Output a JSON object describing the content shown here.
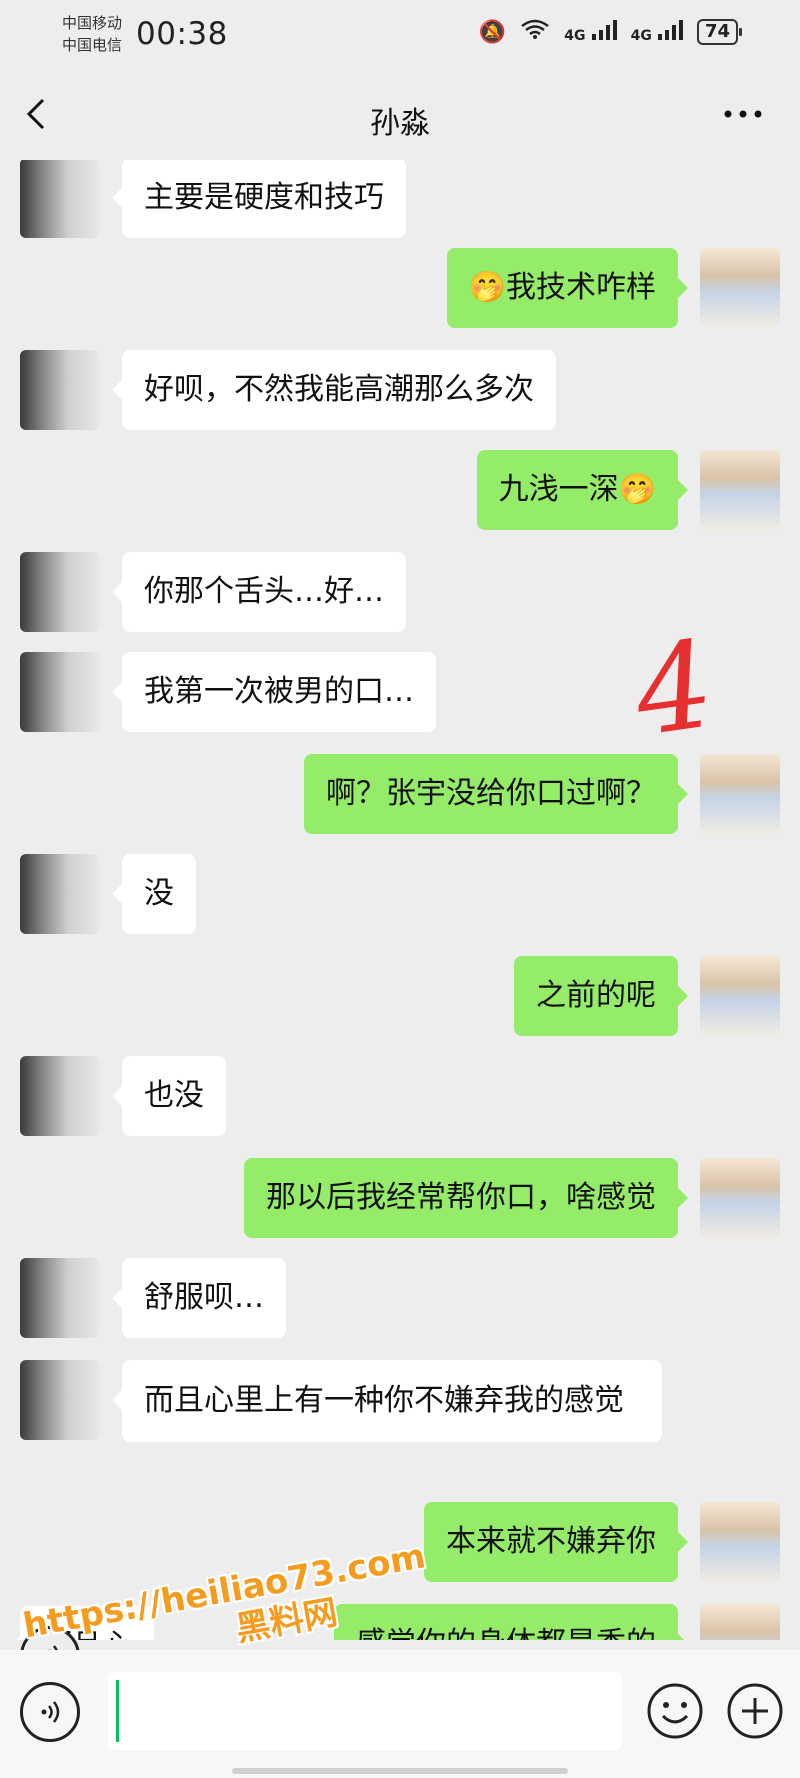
{
  "status_bar": {
    "carrier_1": "中国移动",
    "carrier_2": "中国电信",
    "time": "00:38",
    "signal_1": "4G",
    "signal_2": "4G",
    "battery": "74"
  },
  "header": {
    "title": "孙淼"
  },
  "messages": [
    {
      "side": "in",
      "text": "主要是硬度和技巧"
    },
    {
      "side": "out",
      "text": "我技术咋样",
      "emoji_before": "🤭"
    },
    {
      "side": "in",
      "text": "好呗，不然我能高潮那么多次"
    },
    {
      "side": "out",
      "text": "九浅一深",
      "emoji_after": "🤭"
    },
    {
      "side": "in",
      "text": "你那个舌头…好…"
    },
    {
      "side": "in",
      "text": "我第一次被男的口…"
    },
    {
      "side": "out",
      "text": "啊？张宇没给你口过啊？"
    },
    {
      "side": "in",
      "text": "没"
    },
    {
      "side": "out",
      "text": "之前的呢"
    },
    {
      "side": "in",
      "text": "也没"
    },
    {
      "side": "out",
      "text": "那以后我经常帮你口，啥感觉"
    },
    {
      "side": "in",
      "text": "舒服呗…"
    },
    {
      "side": "in",
      "text": "而且心里上有一种你不嫌弃我的感觉"
    },
    {
      "side": "out",
      "text": "本来就不嫌弃你"
    },
    {
      "side": "in",
      "text": "而且心"
    },
    {
      "side": "out",
      "text": "感觉你的身体都是香的"
    }
  ],
  "annotation": "4",
  "watermark": {
    "url": "https://heiliao73.com",
    "name": "黑料网"
  },
  "icons": {
    "back": "chevron-left-icon",
    "more": "more-dots-icon",
    "voice": "voice-icon",
    "emoji": "smiley-icon",
    "plus": "plus-circle-icon"
  },
  "colors": {
    "background": "#ededed",
    "outgoing_bubble": "#95ec69",
    "incoming_bubble": "#ffffff",
    "watermark": "#f59b1e",
    "scribble": "#e63030"
  }
}
